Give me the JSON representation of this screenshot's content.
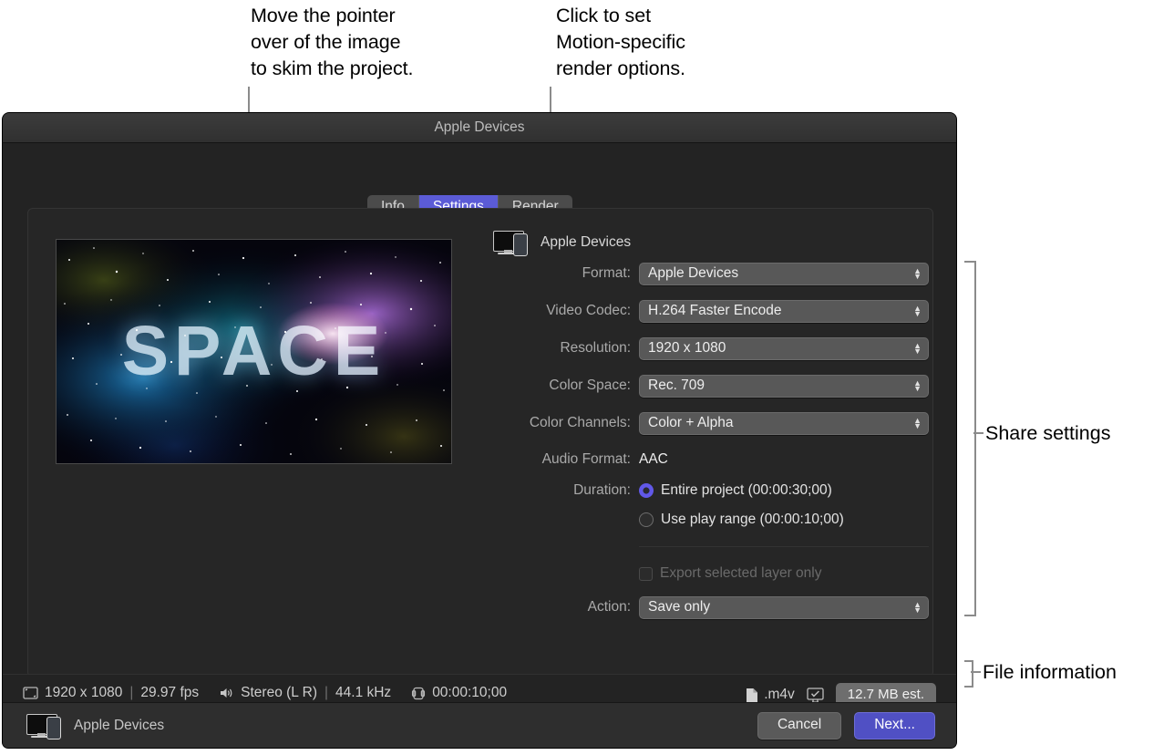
{
  "callouts": {
    "skim": "Move the pointer\nover of the image\nto skim the project.",
    "render": "Click to set\nMotion-specific\nrender options."
  },
  "annotations": {
    "share_settings": "Share settings",
    "file_information": "File information"
  },
  "dialog": {
    "title": "Apple Devices",
    "tabs": [
      {
        "label": "Info",
        "active": false
      },
      {
        "label": "Settings",
        "active": true
      },
      {
        "label": "Render",
        "active": false
      }
    ],
    "preview": {
      "word": "SPACE",
      "icon": "video-preview"
    },
    "destination": {
      "name": "Apple Devices",
      "icon": "apple-devices-icon"
    },
    "fields": [
      {
        "label": "Format:",
        "value": "Apple Devices",
        "type": "popup"
      },
      {
        "label": "Video Codec:",
        "value": "H.264 Faster Encode",
        "type": "popup"
      },
      {
        "label": "Resolution:",
        "value": "1920 x 1080",
        "type": "popup"
      },
      {
        "label": "Color Space:",
        "value": "Rec. 709",
        "type": "popup"
      },
      {
        "label": "Color Channels:",
        "value": "Color + Alpha",
        "type": "popup"
      },
      {
        "label": "Audio Format:",
        "value": "AAC",
        "type": "static"
      }
    ],
    "duration": {
      "label": "Duration:",
      "options": [
        {
          "label": "Entire project (00:00:30;00)",
          "selected": true
        },
        {
          "label": "Use play range (00:00:10;00)",
          "selected": false
        }
      ]
    },
    "export_layer": {
      "label": "Export selected layer only",
      "checked": false,
      "disabled": true
    },
    "action": {
      "label": "Action:",
      "value": "Save only",
      "type": "popup"
    },
    "status": {
      "resolution": "1920 x 1080",
      "fps": "29.97 fps",
      "audio": "Stereo (L R)",
      "sample_rate": "44.1 kHz",
      "duration": "00:00:10;00",
      "extension": ".m4v",
      "size": "12.7 MB est.",
      "icons": {
        "frame": "frame-size-icon",
        "speaker": "speaker-icon",
        "timecode": "timecode-icon",
        "file": "file-icon",
        "display": "display-check-icon"
      }
    },
    "footer": {
      "name": "Apple Devices",
      "cancel": "Cancel",
      "next": "Next..."
    }
  },
  "colors": {
    "accent": "#5b5bd6",
    "primary_button": "#5050c4",
    "radio_on": "#6158e8",
    "window_bg": "#232323",
    "popup_bg": "#585858"
  }
}
